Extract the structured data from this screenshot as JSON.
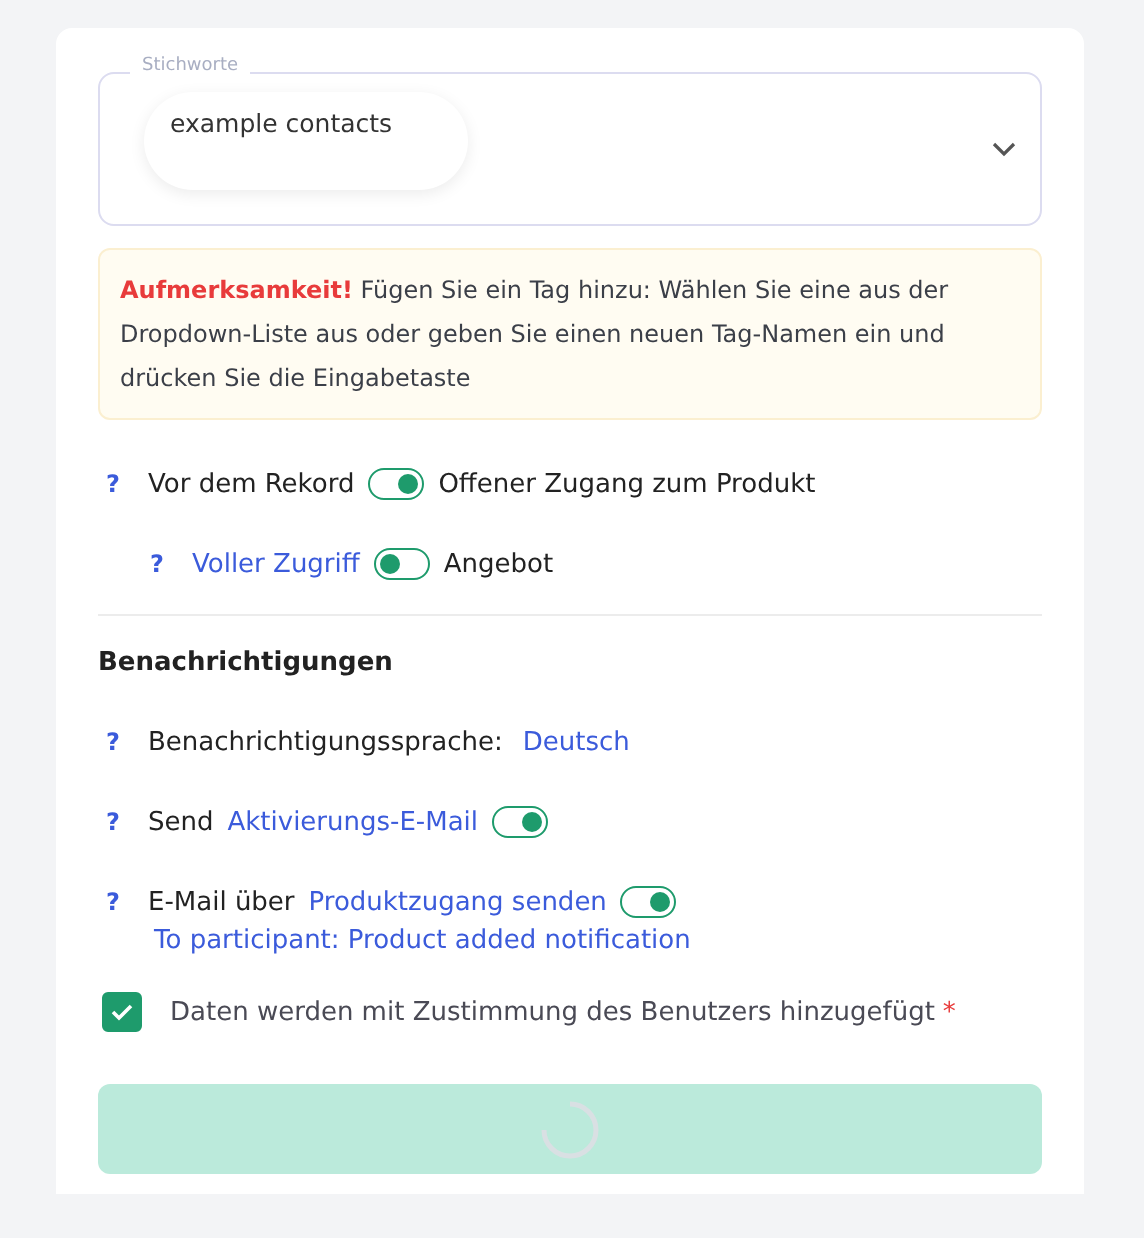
{
  "tags_field": {
    "label": "Stichworte",
    "chips": [
      "example contacts"
    ]
  },
  "alert": {
    "title": "Aufmerksamkeit!",
    "text": "Fügen Sie ein Tag hinzu: Wählen Sie eine aus der Dropdown-Liste aus oder geben Sie einen neuen Tag-Namen ein und drücken Sie die Eingabetaste"
  },
  "access": [
    {
      "help": "?",
      "label": "Vor dem Rekord",
      "kind": "text",
      "on": true,
      "text": "Offener Zugang zum Produkt",
      "children": [
        {
          "help": "?",
          "label": "Voller Zugriff",
          "kind": "link",
          "on": false,
          "text": "Angebot"
        }
      ]
    }
  ],
  "notifications": {
    "heading": "Benachrichtigungen",
    "rows": [
      {
        "kind": "select",
        "help": "?",
        "label": "Benachrichtigungssprache:",
        "value": "Deutsch"
      },
      {
        "kind": "toggle",
        "help": "?",
        "label": "Send",
        "link": "Aktivierungs-E-Mail",
        "on": true
      },
      {
        "kind": "toggle",
        "help": "?",
        "label": "E-Mail über",
        "link": "Produktzugang senden",
        "on": true,
        "sub_link": "To participant: Product added notification"
      }
    ]
  },
  "consent": {
    "checked": true,
    "text": "Daten werden mit Zustimmung des Benutzers hinzugefügt",
    "required_mark": "*"
  },
  "submit": {
    "loading": true
  }
}
